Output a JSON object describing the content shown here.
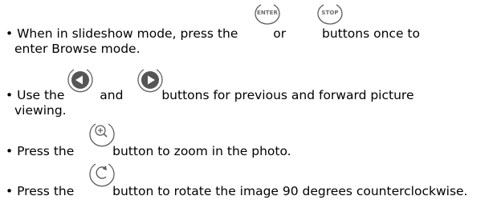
{
  "bullet": "•",
  "items": [
    {
      "line1_a": "When in slideshow mode, press the",
      "line1_b": "or",
      "line1_c": "buttons once to",
      "line2": "enter Browse mode.",
      "buttons": [
        "ENTER",
        "STOP"
      ]
    },
    {
      "line1_a": "Use the",
      "line1_b": "and",
      "line1_c": "buttons for previous and forward picture",
      "line2": "viewing.",
      "icons": [
        "previous-icon",
        "forward-icon"
      ]
    },
    {
      "line1_a": "Press the",
      "line1_c": "button to zoom in the photo.",
      "icons": [
        "zoom-in-icon"
      ]
    },
    {
      "line1_a": "Press the",
      "line1_c": "button to rotate the image 90 degrees counterclockwise.",
      "icons": [
        "rotate-icon"
      ]
    }
  ],
  "colors": {
    "text": "#000000",
    "button_outline": "#5e5e5e",
    "button_label": "#6b6b6b"
  }
}
